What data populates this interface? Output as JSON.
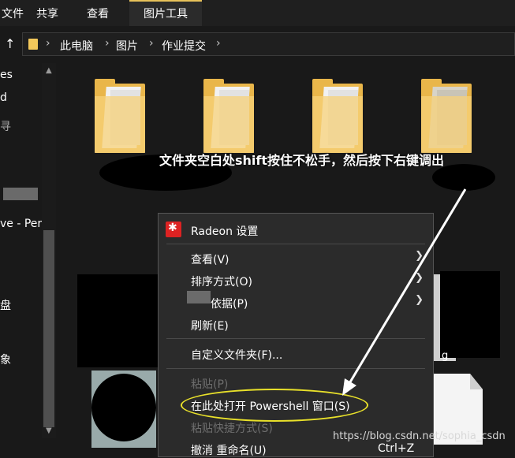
{
  "ribbon": {
    "tabs": [
      {
        "label": "文件"
      },
      {
        "label": "共享"
      },
      {
        "label": "查看"
      },
      {
        "label": "图片工具"
      }
    ]
  },
  "address": {
    "breadcrumbs": [
      "此电脑",
      "图片",
      "作业提交"
    ],
    "separator": "›"
  },
  "nav": {
    "items": [
      "es",
      "d",
      "寻",
      "ve - Per",
      "盘",
      "象"
    ]
  },
  "annotation": {
    "caption": "文件夹空白处shift按住不松手，然后按下右键调出",
    "ellipse_color": "#e9e12a",
    "arrow_color": "#ffffff"
  },
  "context_menu": {
    "items": [
      {
        "label": "Radeon 设置",
        "icon": "radeon-icon"
      },
      {
        "label": "查看(V)"
      },
      {
        "label": "排序方式(O)"
      },
      {
        "label": "依据(P)"
      },
      {
        "label": "刷新(E)"
      },
      {
        "label": "自定义文件夹(F)..."
      },
      {
        "label": "粘贴(P)"
      },
      {
        "label": "在此处打开 Powershell 窗口(S)"
      },
      {
        "label": "粘贴快捷方式(S)"
      },
      {
        "label": "撤消 重命名(U)",
        "shortcut": "Ctrl+Z"
      }
    ]
  },
  "watermark": "https://blog.csdn.net/sophia_csdn",
  "thumb_label": "g"
}
